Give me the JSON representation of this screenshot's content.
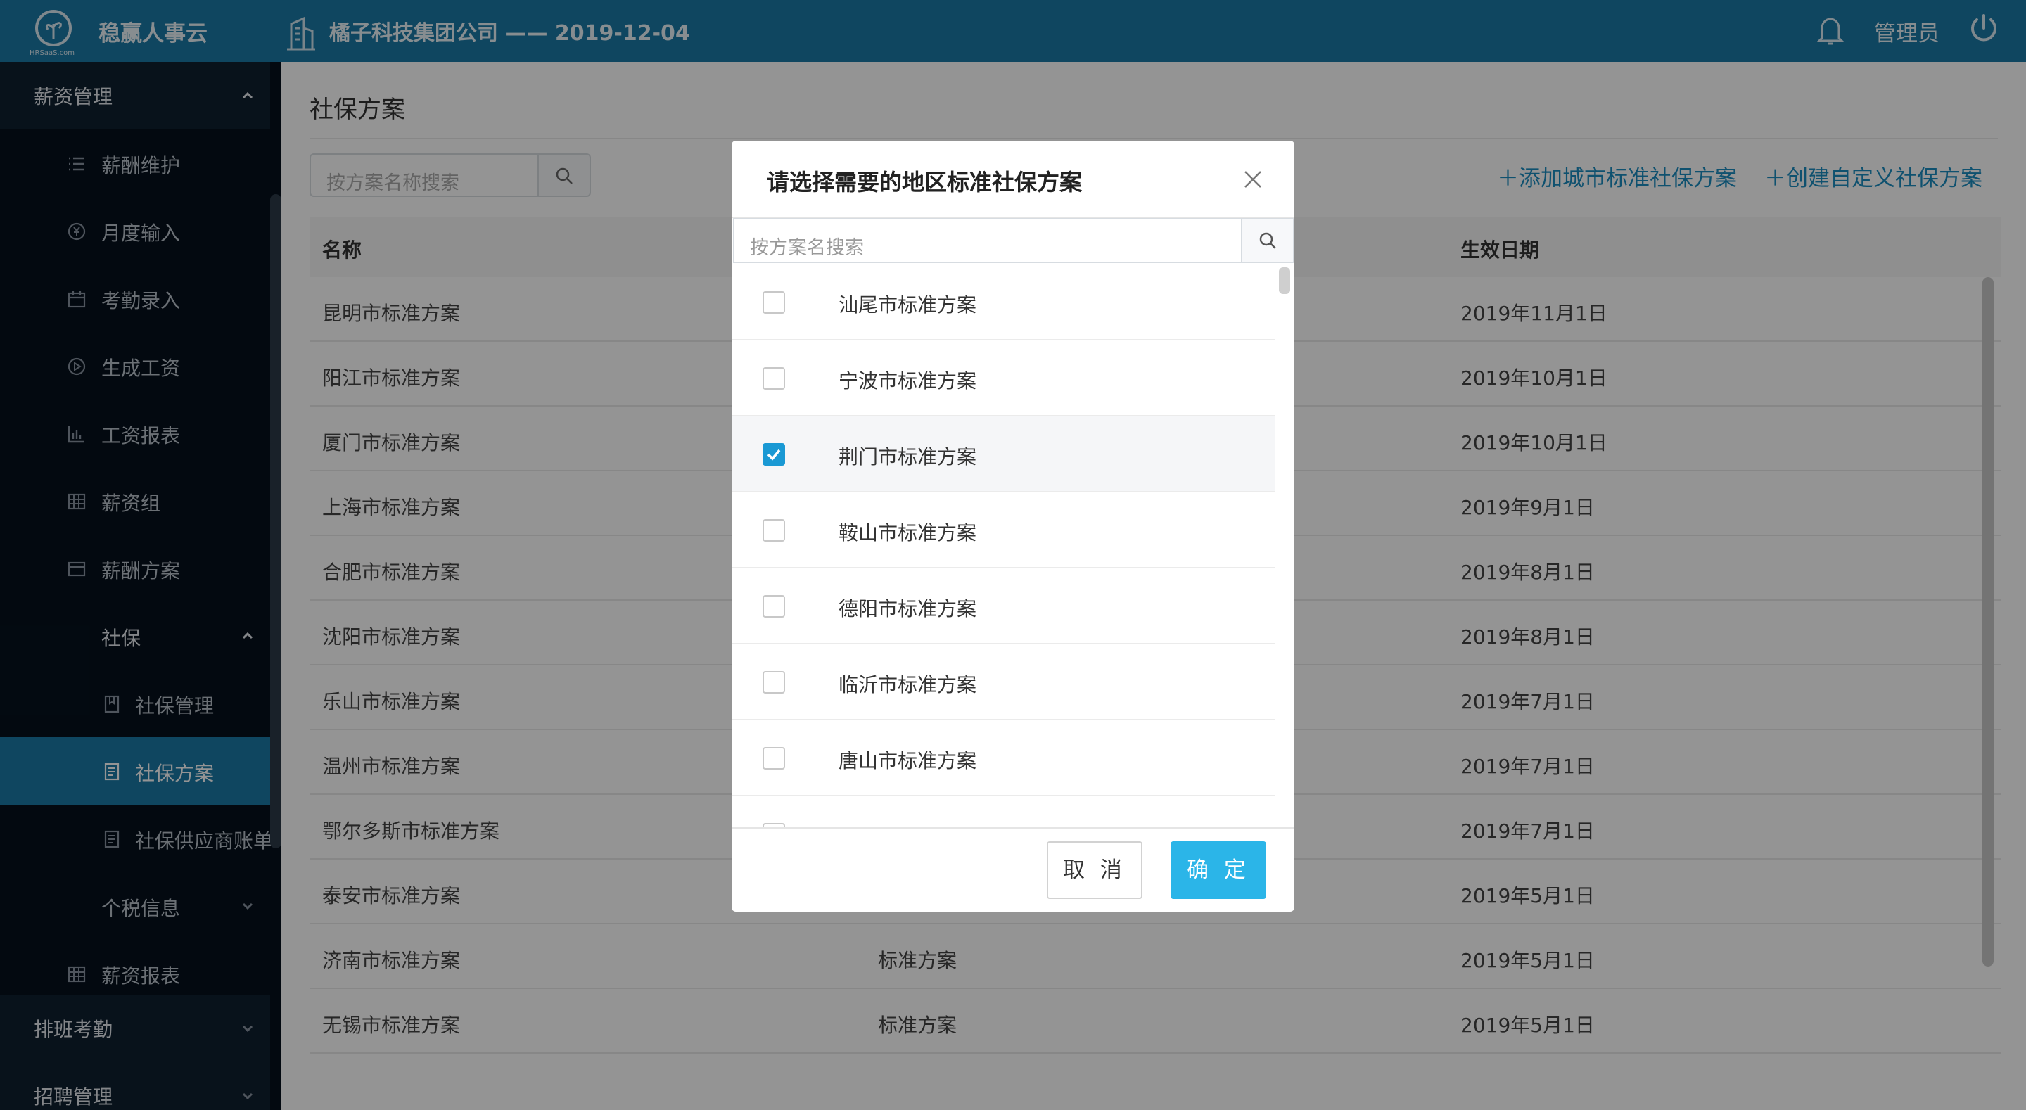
{
  "header": {
    "brand": "稳赢人事云",
    "logo_subtext": "HRSaaS.com",
    "company": "橘子科技集团公司 —— 2019-12-04",
    "user": "管理员"
  },
  "sidebar": {
    "group_salary": "薪资管理",
    "items": [
      {
        "label": "薪酬维护",
        "icon": "list-icon"
      },
      {
        "label": "月度输入",
        "icon": "yen-icon"
      },
      {
        "label": "考勤录入",
        "icon": "calendar-icon"
      },
      {
        "label": "生成工资",
        "icon": "play-icon"
      },
      {
        "label": "工资报表",
        "icon": "bar-chart-icon"
      },
      {
        "label": "薪资组",
        "icon": "grid-icon"
      },
      {
        "label": "薪酬方案",
        "icon": "card-icon"
      },
      {
        "label": "社保",
        "icon": ""
      },
      {
        "label": "社保管理",
        "icon": "book-icon"
      },
      {
        "label": "社保方案",
        "icon": "document-icon"
      },
      {
        "label": "社保供应商账单",
        "icon": "document-icon"
      },
      {
        "label": "个税信息",
        "icon": ""
      },
      {
        "label": "薪资报表",
        "icon": "grid-icon"
      }
    ],
    "group_scheduling": "排班考勤",
    "group_recruit": "招聘管理"
  },
  "main": {
    "title": "社保方案",
    "search_placeholder": "按方案名称搜索",
    "add_city_label": "添加城市标准社保方案",
    "create_custom_label": "创建自定义社保方案",
    "columns": {
      "name": "名称",
      "date": "生效日期"
    },
    "rows": [
      {
        "name": "昆明市标准方案",
        "type": "",
        "date": "2019年11月1日"
      },
      {
        "name": "阳江市标准方案",
        "type": "",
        "date": "2019年10月1日"
      },
      {
        "name": "厦门市标准方案",
        "type": "",
        "date": "2019年10月1日"
      },
      {
        "name": "上海市标准方案",
        "type": "",
        "date": "2019年9月1日"
      },
      {
        "name": "合肥市标准方案",
        "type": "",
        "date": "2019年8月1日"
      },
      {
        "name": "沈阳市标准方案",
        "type": "",
        "date": "2019年8月1日"
      },
      {
        "name": "乐山市标准方案",
        "type": "",
        "date": "2019年7月1日"
      },
      {
        "name": "温州市标准方案",
        "type": "",
        "date": "2019年7月1日"
      },
      {
        "name": "鄂尔多斯市标准方案",
        "type": "",
        "date": "2019年7月1日"
      },
      {
        "name": "泰安市标准方案",
        "type": "",
        "date": "2019年5月1日"
      },
      {
        "name": "济南市标准方案",
        "type": "标准方案",
        "date": "2019年5月1日"
      },
      {
        "name": "无锡市标准方案",
        "type": "标准方案",
        "date": "2019年5月1日"
      }
    ]
  },
  "modal": {
    "title": "请选择需要的地区标准社保方案",
    "search_placeholder": "按方案名搜索",
    "options": [
      {
        "label": "汕尾市标准方案",
        "checked": false
      },
      {
        "label": "宁波市标准方案",
        "checked": false
      },
      {
        "label": "荆门市标准方案",
        "checked": true
      },
      {
        "label": "鞍山市标准方案",
        "checked": false
      },
      {
        "label": "德阳市标准方案",
        "checked": false
      },
      {
        "label": "临沂市标准方案",
        "checked": false
      },
      {
        "label": "唐山市标准方案",
        "checked": false
      },
      {
        "label": "乌鲁木齐市标准方案",
        "checked": false
      }
    ],
    "cancel_label": "取 消",
    "ok_label": "确 定"
  },
  "colors": {
    "header_bg": "#1a79a6",
    "sidebar_bg": "#06111d",
    "active_item": "#1a79a6",
    "link": "#1a8cc0",
    "primary_button": "#2bb5e8",
    "checkbox_checked": "#1a99d4"
  }
}
